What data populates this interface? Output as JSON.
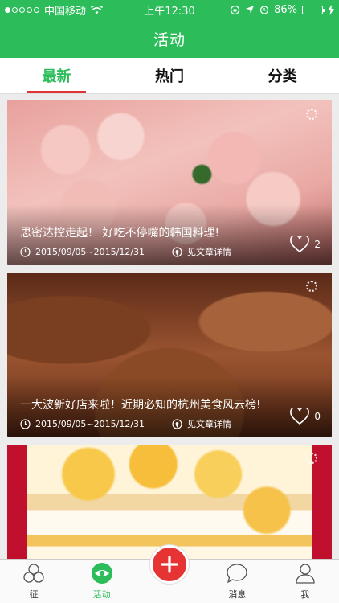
{
  "status": {
    "carrier": "中国移动",
    "time": "上午12:30",
    "battery": "86%",
    "battery_level": 0.86
  },
  "nav": {
    "title": "活动"
  },
  "tabs": [
    {
      "label": "最新",
      "active": true
    },
    {
      "label": "热门",
      "active": false
    },
    {
      "label": "分类",
      "active": false
    }
  ],
  "cards": [
    {
      "title": "思密达控走起！ 好吃不停嘴的韩国料理!",
      "date": "2015/09/05~2015/12/31",
      "location": "见文章详情",
      "likes": "2",
      "image": "pork-slices-photo"
    },
    {
      "title": "一大波新好店来啦！近期必知的杭州美食风云榜!",
      "date": "2015/09/05~2015/12/31",
      "location": "见文章详情",
      "likes": "0",
      "image": "chocolate-truffle-photo"
    },
    {
      "title": "",
      "date": "",
      "location": "",
      "likes": "",
      "image": "mango-cake-photo"
    }
  ],
  "tabbar": [
    {
      "label": "征",
      "icon": "hexagon-cluster-icon"
    },
    {
      "label": "活动",
      "icon": "eye-icon",
      "active": true
    },
    {
      "label": "",
      "icon": "plus-icon"
    },
    {
      "label": "消息",
      "icon": "chat-bubble-icon"
    },
    {
      "label": "我",
      "icon": "person-icon"
    }
  ],
  "colors": {
    "brand": "#2cbd5a",
    "accent": "#e63434"
  }
}
